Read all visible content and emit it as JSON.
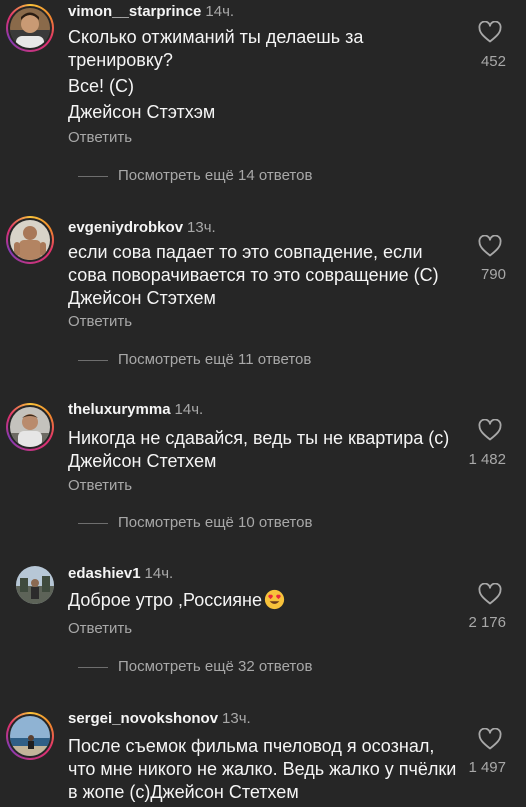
{
  "comments": [
    {
      "username": "vimon__starprince",
      "time": "14ч.",
      "lines": [
        "Сколько отжиманий ты делаешь за тренировку?",
        "Все! (С)",
        "Джейсон Стэтхэм"
      ],
      "reply": "Ответить",
      "likes": "452",
      "more": "Посмотреть ещё 14 ответов"
    },
    {
      "username": "evgeniydrobkov",
      "time": "13ч.",
      "lines": [
        "если сова падает то это совпадение, если сова поворачивается то это совращение (С) Джейсон Стэтхем"
      ],
      "reply": "Ответить",
      "likes": "790",
      "more": "Посмотреть ещё 11 ответов"
    },
    {
      "username": "theluxurymma",
      "time": "14ч.",
      "lines": [
        "Никогда не сдавайся, ведь ты не квартира (с) Джейсон Стетхем"
      ],
      "reply": "Ответить",
      "likes": "1 482",
      "more": "Посмотреть ещё 10 ответов"
    },
    {
      "username": "edashiev1",
      "time": "14ч.",
      "lines": [
        "Доброе утро ,Россияне"
      ],
      "emoji": "smiling-face-with-heart-eyes",
      "reply": "Ответить",
      "likes": "2 176",
      "more": "Посмотреть ещё 32 ответов"
    },
    {
      "username": "sergei_novokshonov",
      "time": "13ч.",
      "lines": [
        "После съемок фильма пчеловод я осознал, что мне никого не жалко. Ведь жалко у пчёлки в жопе (с)Джейсон Стетхем"
      ],
      "likes": "1 497"
    }
  ],
  "icons": {
    "heart": "heart-outline-icon"
  },
  "colors": {
    "background": "#262626",
    "text": "#f5f5f5",
    "secondary": "#a8a8a8"
  }
}
